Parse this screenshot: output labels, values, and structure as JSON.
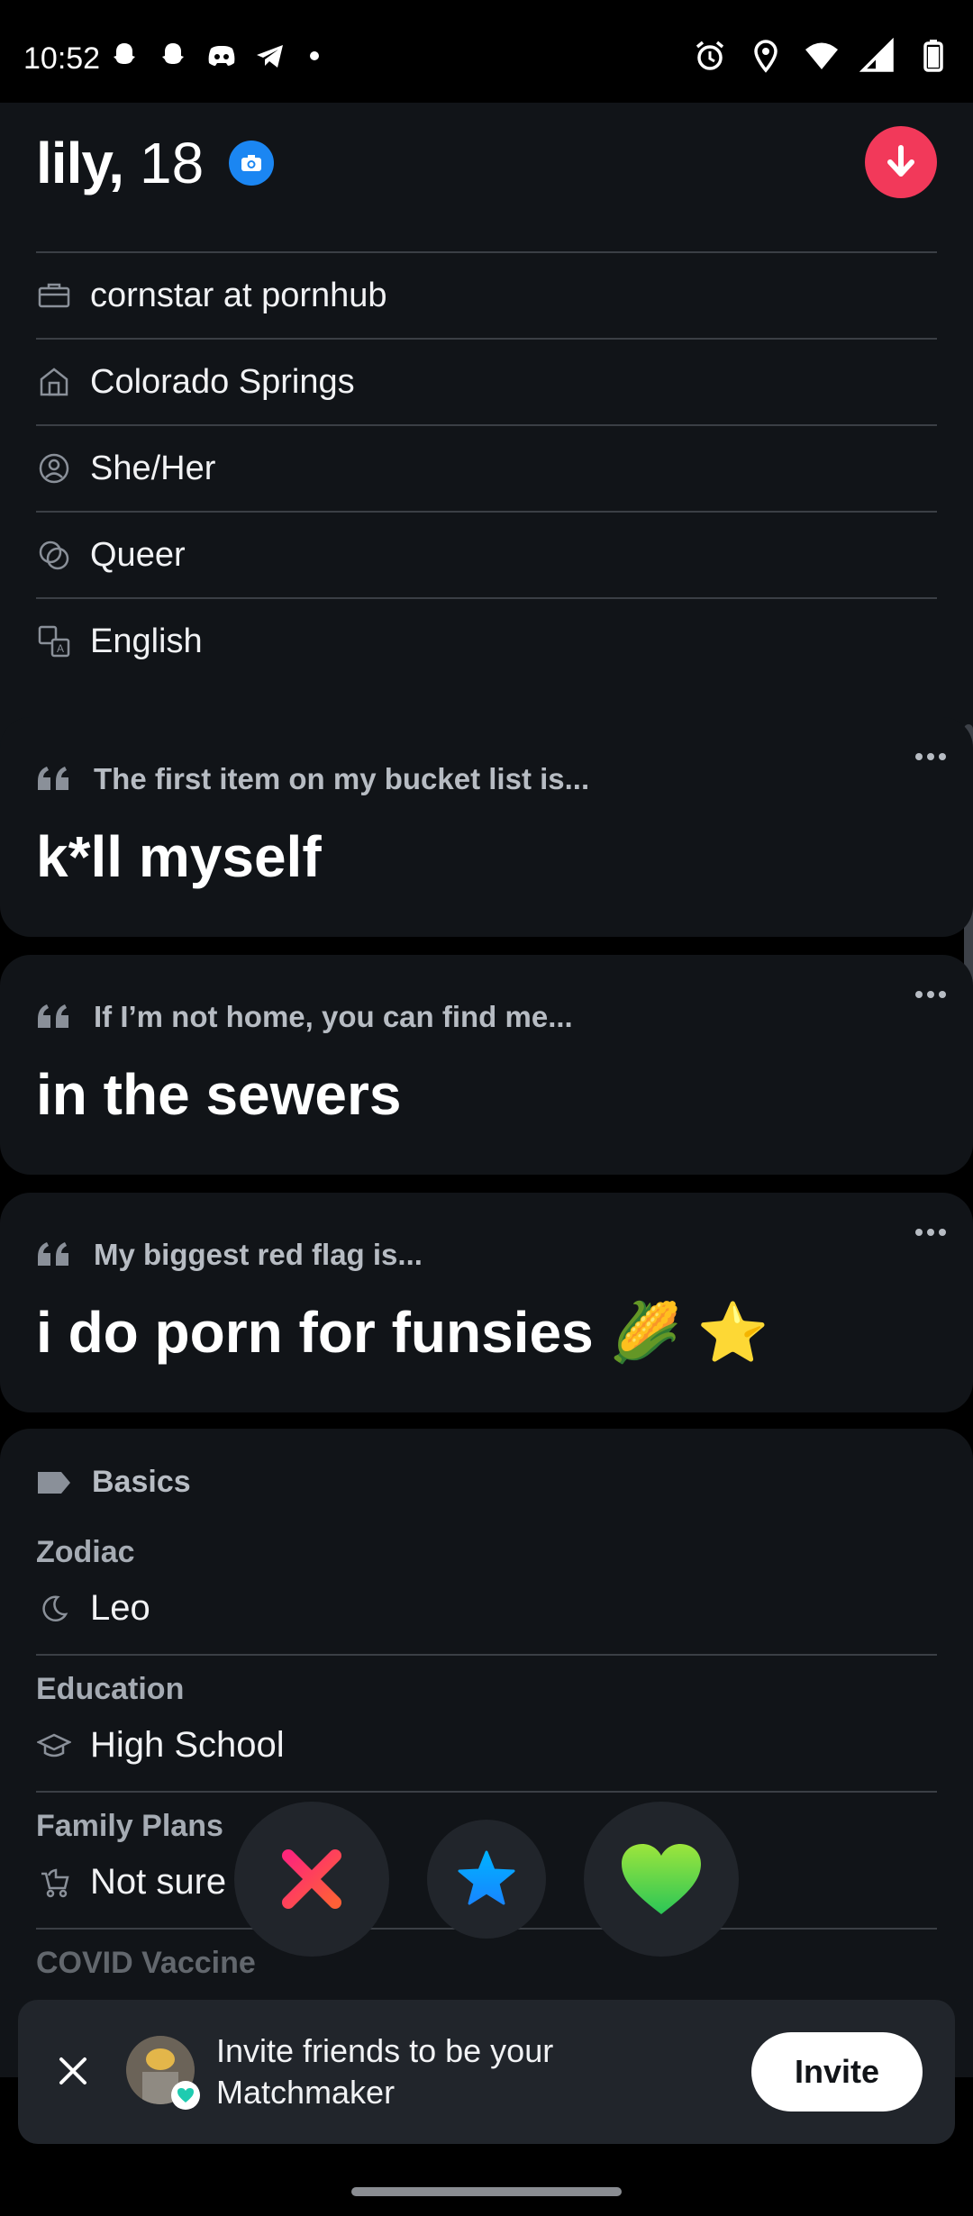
{
  "status_bar": {
    "time": "10:52",
    "left_icons": [
      "snapchat-icon",
      "snapchat-icon",
      "discord-icon",
      "telegram-icon",
      "dot-icon"
    ],
    "right_icons": [
      "alarm-icon",
      "location-icon",
      "wifi-icon",
      "signal-icon",
      "battery-icon"
    ]
  },
  "profile": {
    "name": "lily,",
    "age": "18",
    "verified_icon": "camera-verified-icon",
    "info": [
      {
        "icon": "briefcase-icon",
        "text": "cornstar at pornhub"
      },
      {
        "icon": "home-icon",
        "text": "Colorado Springs"
      },
      {
        "icon": "pronoun-icon",
        "text": "She/Her"
      },
      {
        "icon": "orientation-icon",
        "text": "Queer"
      },
      {
        "icon": "language-icon",
        "text": "English"
      }
    ]
  },
  "prompts": [
    {
      "question": "The first item on my bucket list is...",
      "answer": "k*ll myself"
    },
    {
      "question": "If I’m not home, you can find me...",
      "answer": "in the sewers"
    },
    {
      "question": "My biggest red flag is...",
      "answer": "i do porn for funsies 🌽 ⭐"
    }
  ],
  "basics": {
    "title": "Basics",
    "groups": [
      {
        "label": "Zodiac",
        "icon": "moon-icon",
        "value": "Leo"
      },
      {
        "label": "Education",
        "icon": "graduation-cap-icon",
        "value": "High School"
      },
      {
        "label": "Family Plans",
        "icon": "stroller-icon",
        "value": "Not sure"
      },
      {
        "label": "COVID Vaccine",
        "icon": "",
        "value": ""
      }
    ]
  },
  "actions": {
    "nope": "close-x-icon",
    "super_like": "star-icon",
    "like": "heart-icon"
  },
  "invite_banner": {
    "message": "Invite friends to be your Matchmaker",
    "button": "Invite"
  },
  "colors": {
    "card_bg": "#111418",
    "divider": "#3b3f45",
    "nope_pink": "#fd267a",
    "super_blue": "#1786ff",
    "like_green": "#4fd34a",
    "rewind_red": "#f2395a"
  }
}
